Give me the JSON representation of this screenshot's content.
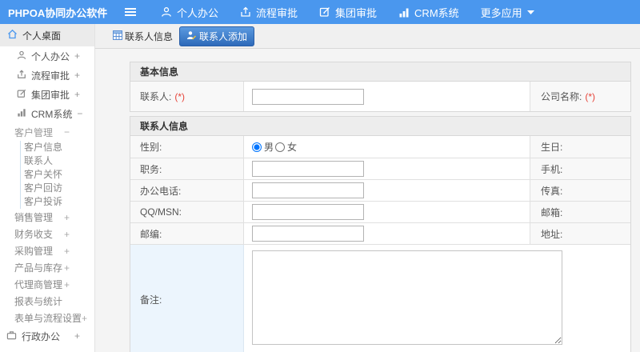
{
  "topbar": {
    "logo": "PHPOA协同办公软件",
    "nav": [
      {
        "label": "个人办公",
        "icon": "user-icon"
      },
      {
        "label": "流程审批",
        "icon": "share-icon"
      },
      {
        "label": "集团审批",
        "icon": "edit-icon"
      },
      {
        "label": "CRM系统",
        "icon": "bar-chart-icon"
      },
      {
        "label": "更多应用",
        "icon": "caret-down-icon"
      }
    ]
  },
  "sidebar": {
    "desktop_label": "个人桌面",
    "top_items": [
      {
        "label": "个人办公",
        "toggle": "+",
        "icon": "user-icon"
      },
      {
        "label": "流程审批",
        "toggle": "+",
        "icon": "share-icon"
      },
      {
        "label": "集团审批",
        "toggle": "+",
        "icon": "edit-icon"
      },
      {
        "label": "CRM系统",
        "toggle": "−",
        "icon": "bar-chart-icon"
      }
    ],
    "crm": {
      "group": {
        "label": "客户管理",
        "toggle": "−"
      },
      "sub_items": [
        "客户信息",
        "联系人",
        "客户关怀",
        "客户回访",
        "客户投诉"
      ],
      "siblings": [
        {
          "label": "销售管理",
          "toggle": "+"
        },
        {
          "label": "财务收支",
          "toggle": "+"
        },
        {
          "label": "采购管理",
          "toggle": "+"
        },
        {
          "label": "产品与库存",
          "toggle": "+"
        },
        {
          "label": "代理商管理",
          "toggle": "+"
        },
        {
          "label": "报表与统计",
          "toggle": ""
        },
        {
          "label": "表单与流程设置",
          "toggle": "+"
        }
      ]
    },
    "bottom_item": {
      "label": "行政办公",
      "toggle": "+",
      "icon": "briefcase-icon"
    }
  },
  "tabs": [
    {
      "label": "联系人信息",
      "active": false,
      "icon": "table-grid-icon"
    },
    {
      "label": "联系人添加",
      "active": true,
      "icon": "contact-add-icon"
    }
  ],
  "form": {
    "sections": [
      {
        "title": "基本信息"
      },
      {
        "title": "联系人信息"
      }
    ],
    "basic_row": {
      "label": "联系人:",
      "required_mark": "(*)",
      "value": "",
      "label_right": "公司名称:",
      "required_mark_right": "(*)"
    },
    "contact_rows": [
      {
        "label": "性别:",
        "label_right": "生日:",
        "male": "男",
        "female": "女",
        "selected": "男"
      },
      {
        "label": "职务:",
        "value": "",
        "label_right": "手机:"
      },
      {
        "label": "办公电话:",
        "value": "",
        "label_right": "传真:"
      },
      {
        "label": "QQ/MSN:",
        "value": "",
        "label_right": "邮箱:"
      },
      {
        "label": "邮编:",
        "value": "",
        "label_right": "地址:"
      },
      {
        "label": "备注:",
        "value": ""
      }
    ]
  },
  "colors": {
    "topbar_blue": "#4a97ee",
    "active_tab_blue": "#2e6ab9",
    "required_red": "#e6443a",
    "note_label_bg": "#ecf5fd"
  }
}
